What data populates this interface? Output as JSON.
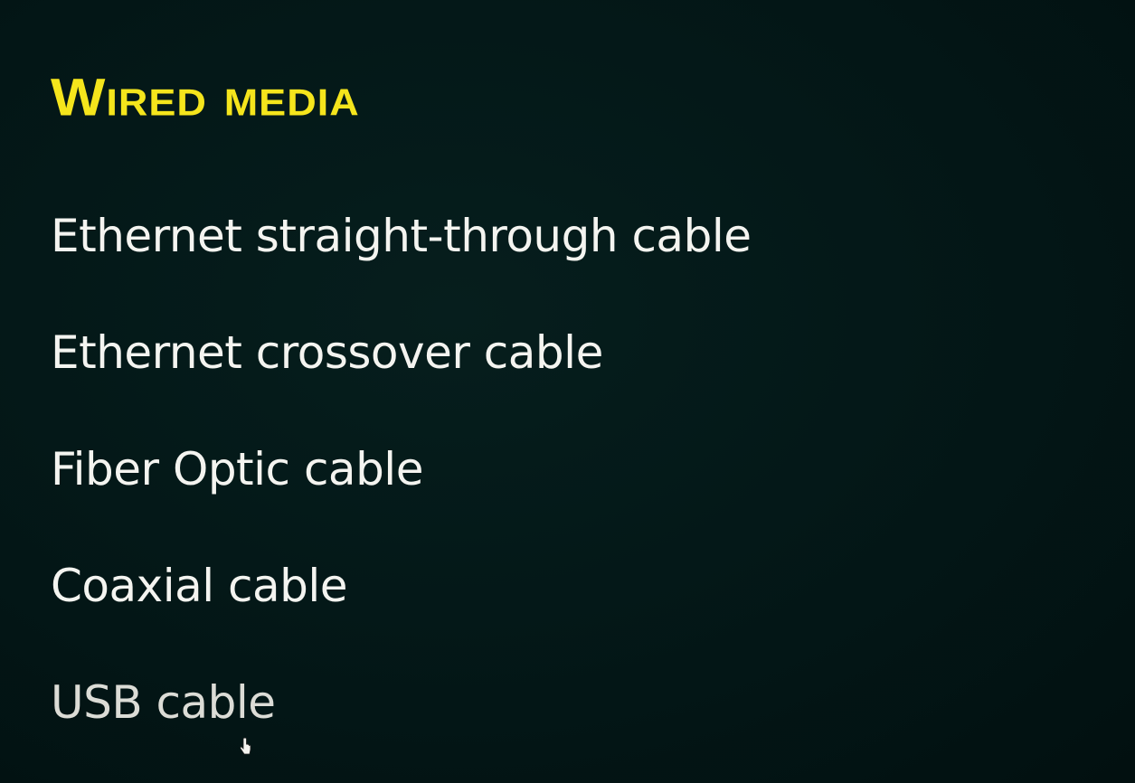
{
  "slide": {
    "title": "Wired media",
    "items": [
      "Ethernet straight-through cable",
      "Ethernet crossover cable",
      "Fiber Optic cable",
      "Coaxial cable",
      "USB cable"
    ]
  },
  "colors": {
    "background": "#031616",
    "title": "#f5e51c",
    "text": "#f4f4f0"
  },
  "icons": {
    "cursor": "hand-pointer-icon"
  }
}
